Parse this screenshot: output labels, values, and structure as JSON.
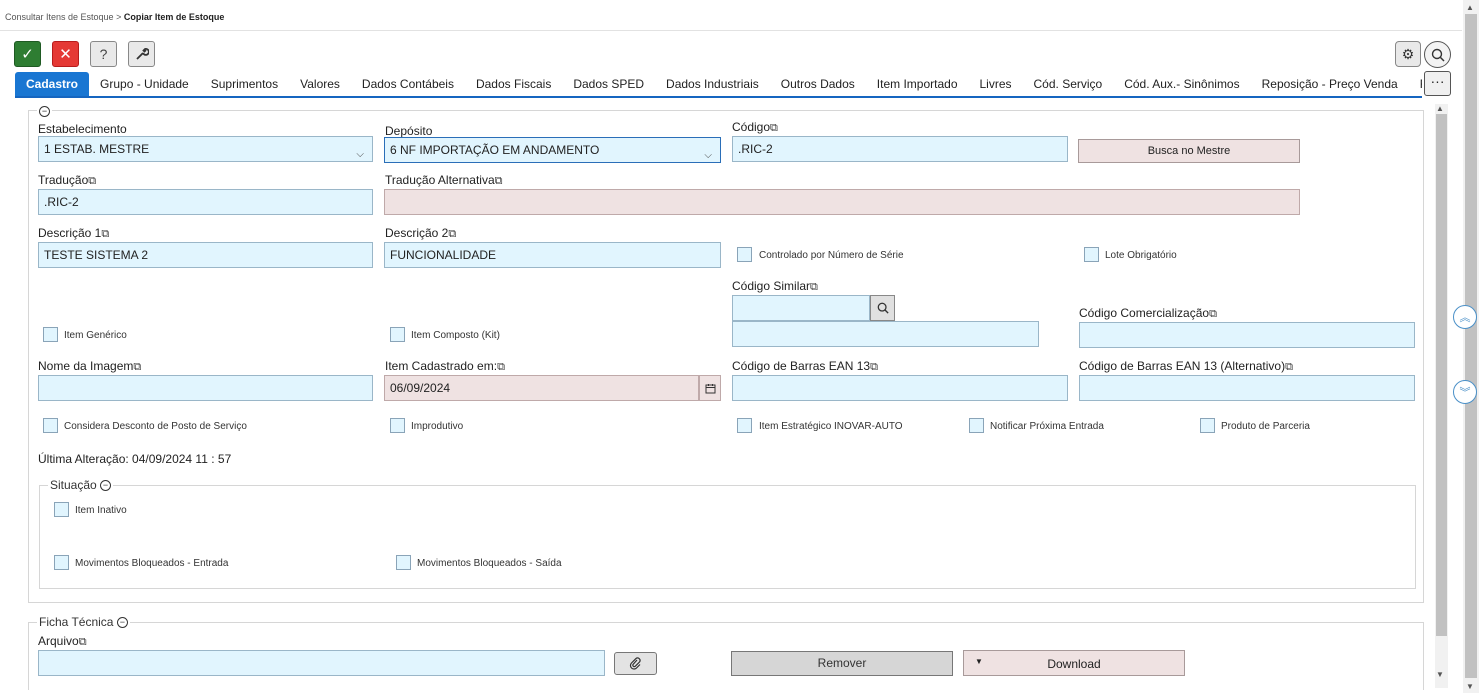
{
  "breadcrumb": {
    "parent": "Consultar Itens de Estoque",
    "separator": ">",
    "current": "Copiar Item de Estoque"
  },
  "toolbar": {
    "ok": "✓",
    "cancel": "✕",
    "help": "?",
    "tools": "🔧",
    "more": "···"
  },
  "tabs": [
    "Cadastro",
    "Grupo - Unidade",
    "Suprimentos",
    "Valores",
    "Dados Contábeis",
    "Dados Fiscais",
    "Dados SPED",
    "Dados Industriais",
    "Outros Dados",
    "Item Importado",
    "Livres",
    "Cód. Serviço",
    "Cód. Aux.- Sinônimos",
    "Reposição - Preço Venda",
    "Fabricante X Referê"
  ],
  "form": {
    "estabelecimento": {
      "label": "Estabelecimento",
      "value": "1 ESTAB. MESTRE"
    },
    "deposito": {
      "label": "Depósito",
      "value": "6 NF IMPORTAÇÃO EM ANDAMENTO"
    },
    "codigo": {
      "label": "Código",
      "value": ".RIC-2"
    },
    "busca_button": "Busca no Mestre",
    "traducao": {
      "label": "Tradução",
      "value": ".RIC-2"
    },
    "traducao_alt": {
      "label": "Tradução Alternativa",
      "value": ""
    },
    "descricao1": {
      "label": "Descrição 1",
      "value": "TESTE SISTEMA 2"
    },
    "descricao2": {
      "label": "Descrição 2",
      "value": "FUNCIONALIDADE"
    },
    "controlado_serie": "Controlado por Número de Série",
    "lote_obrigatorio": "Lote Obrigatório",
    "codigo_similar": {
      "label": "Código Similar",
      "value": ""
    },
    "item_generico": "Item Genérico",
    "item_composto": "Item Composto (Kit)",
    "codigo_comercializacao": {
      "label": "Código Comercialização",
      "value": ""
    },
    "nome_imagem": {
      "label": "Nome da Imagem",
      "value": ""
    },
    "item_cadastrado": {
      "label": "Item Cadastrado em:",
      "value": "06/09/2024"
    },
    "ean13": {
      "label": "Código de Barras EAN 13",
      "value": ""
    },
    "ean13_alt": {
      "label": "Código de Barras EAN 13 (Alternativo)",
      "value": ""
    },
    "considera_desconto": "Considera Desconto de Posto de Serviço",
    "improdutivo": "Improdutivo",
    "item_estrategico": "Item Estratégico INOVAR-AUTO",
    "notificar_entrada": "Notificar Próxima Entrada",
    "produto_parceria": "Produto de Parceria",
    "ultima_alteracao": "Última Alteração: 04/09/2024 11 : 57"
  },
  "situacao": {
    "legend": "Situação",
    "item_inativo": "Item Inativo",
    "bloq_entrada": "Movimentos Bloqueados - Entrada",
    "bloq_saida": "Movimentos Bloqueados - Saída"
  },
  "ficha": {
    "legend": "Ficha Técnica",
    "arquivo": {
      "label": "Arquivo",
      "value": ""
    },
    "remover": "Remover",
    "download": "Download"
  },
  "icons": {
    "minus": "−",
    "copy": "⧉",
    "chevron": "⌵",
    "gear": "⚙",
    "search": "⌕",
    "calendar": "📅",
    "clip": "📎",
    "up": "⌃",
    "down": "⌄",
    "caret": "▼",
    "scroll_up": "▲",
    "scroll_down": "▼"
  },
  "colors": {
    "active_tab": "#1976d2",
    "input_bg": "#e1f5fe",
    "readonly_bg": "#efe2e2",
    "ok": "#2e7d32",
    "cancel": "#e53935"
  }
}
